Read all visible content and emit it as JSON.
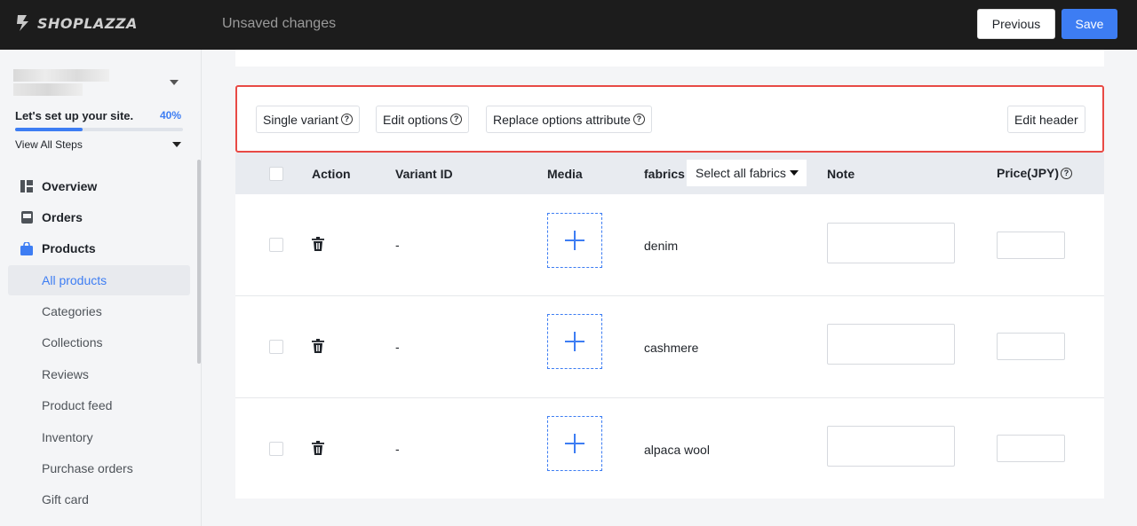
{
  "header": {
    "logo_text": "SHOPLAZZA",
    "status": "Unsaved changes",
    "previous_label": "Previous",
    "save_label": "Save"
  },
  "setup": {
    "title": "Let's set up your site.",
    "percent_label": "40%",
    "progress": 0.4,
    "view_steps_label": "View All Steps"
  },
  "nav": {
    "overview": "Overview",
    "orders": "Orders",
    "products": "Products",
    "sub_items": [
      "All products",
      "Categories",
      "Collections",
      "Reviews",
      "Product feed",
      "Inventory",
      "Purchase orders",
      "Gift card"
    ]
  },
  "toolbar": {
    "single_variant": "Single variant",
    "edit_options": "Edit options",
    "replace_options": "Replace options attribute",
    "edit_header": "Edit header"
  },
  "table": {
    "columns": {
      "action": "Action",
      "variant_id": "Variant ID",
      "media": "Media",
      "fabrics": "fabrics",
      "select_all_fabrics": "Select all fabrics",
      "note": "Note",
      "price": "Price(JPY)"
    },
    "rows": [
      {
        "variant_id": "-",
        "fabric": "denim"
      },
      {
        "variant_id": "-",
        "fabric": "cashmere"
      },
      {
        "variant_id": "-",
        "fabric": "alpaca wool"
      }
    ]
  },
  "colors": {
    "accent": "#3d7df3",
    "highlight_border": "#e84a45",
    "topbar": "#1c1c1c"
  }
}
